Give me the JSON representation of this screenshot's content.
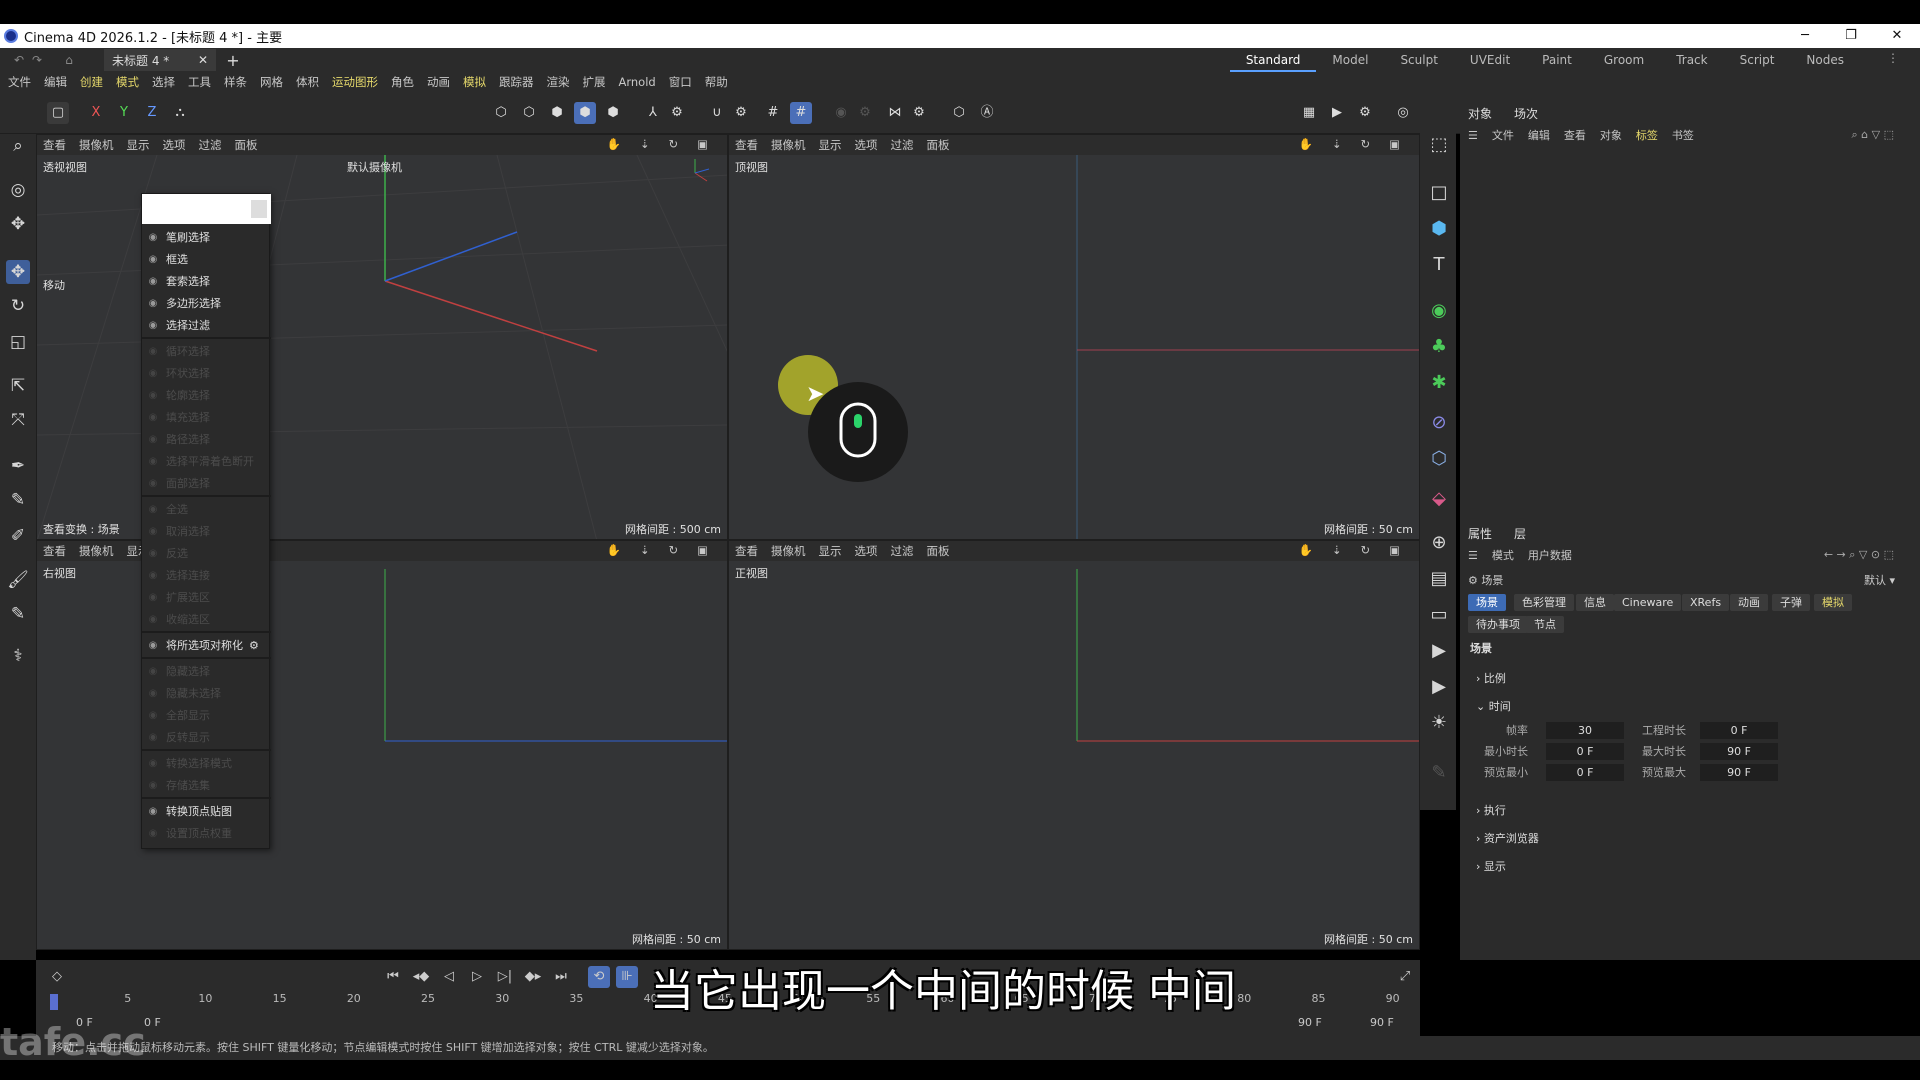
{
  "app": {
    "title": "Cinema 4D 2026.1.2 - [未标题 4 *] - 主要",
    "window_controls": [
      "─",
      "❐",
      "✕"
    ]
  },
  "tabs": {
    "doc_tab": "未标题 4 *",
    "close": "✕",
    "add": "+",
    "layouts": [
      "Standard",
      "Model",
      "Sculpt",
      "UVEdit",
      "Paint",
      "Groom",
      "Track",
      "Script",
      "Nodes"
    ],
    "active_layout": "Standard"
  },
  "menu": [
    "文件",
    "编辑",
    "创建",
    "模式",
    "选择",
    "工具",
    "样条",
    "网格",
    "体积",
    "运动图形",
    "角色",
    "动画",
    "模拟",
    "跟踪器",
    "渲染",
    "扩展",
    "Arnold",
    "窗口",
    "帮助"
  ],
  "axes_buttons": [
    "X",
    "Y",
    "Z"
  ],
  "viewports": {
    "menu": [
      "查看",
      "摄像机",
      "显示",
      "选项",
      "过滤",
      "面板"
    ],
    "perspective": {
      "name": "透视视图",
      "camera": "默认摄像机",
      "grid": "网格间距 : 500 cm",
      "tool": "移动",
      "transform": "查看变换 : 场景"
    },
    "top": {
      "name": "顶视图",
      "grid": "网格间距 : 50 cm"
    },
    "right": {
      "name": "右视图",
      "grid": "网格间距 : 50 cm"
    },
    "front": {
      "name": "正视图",
      "grid": "网格间距 : 50 cm"
    }
  },
  "context_menu": {
    "items": [
      {
        "label": "笔刷选择",
        "enabled": true
      },
      {
        "label": "框选",
        "enabled": true
      },
      {
        "label": "套索选择",
        "enabled": true
      },
      {
        "label": "多边形选择",
        "enabled": true
      },
      {
        "label": "选择过滤",
        "enabled": true
      },
      {
        "label": "循环选择",
        "enabled": false
      },
      {
        "label": "环状选择",
        "enabled": false
      },
      {
        "label": "轮廓选择",
        "enabled": false
      },
      {
        "label": "填充选择",
        "enabled": false
      },
      {
        "label": "路径选择",
        "enabled": false
      },
      {
        "label": "选择平滑着色断开",
        "enabled": false
      },
      {
        "label": "面部选择",
        "enabled": false
      },
      {
        "label": "全选",
        "enabled": false
      },
      {
        "label": "取消选择",
        "enabled": false
      },
      {
        "label": "反选",
        "enabled": false
      },
      {
        "label": "选择连接",
        "enabled": false
      },
      {
        "label": "扩展选区",
        "enabled": false
      },
      {
        "label": "收缩选区",
        "enabled": false
      },
      {
        "label": "将所选项对称化",
        "enabled": true
      },
      {
        "label": "隐藏选择",
        "enabled": false
      },
      {
        "label": "隐藏未选择",
        "enabled": false
      },
      {
        "label": "全部显示",
        "enabled": false
      },
      {
        "label": "反转显示",
        "enabled": false
      },
      {
        "label": "转换选择模式",
        "enabled": false
      },
      {
        "label": "存储选集",
        "enabled": false
      },
      {
        "label": "转换顶点贴图",
        "enabled": true
      },
      {
        "label": "设置顶点权重",
        "enabled": false
      }
    ]
  },
  "object_panel": {
    "tabs": [
      "对象",
      "场次"
    ],
    "menu": [
      "文件",
      "编辑",
      "查看",
      "对象",
      "标签",
      "书签"
    ]
  },
  "attributes_panel": {
    "tabs": [
      "属性",
      "层"
    ],
    "menu": [
      "模式",
      "用户数据"
    ],
    "context": "场景",
    "preset": "默认",
    "chips_row1": [
      "场景",
      "色彩管理",
      "信息",
      "Cineware",
      "XRefs",
      "动画",
      "子弹",
      "模拟"
    ],
    "chips_row2": [
      "待办事项",
      "节点"
    ],
    "heading": "场景",
    "groups": [
      "比例",
      "时间",
      "执行",
      "资产浏览器",
      "显示"
    ],
    "time_fields": [
      {
        "label": "帧率",
        "value": "30",
        "label2": "工程时长",
        "value2": "0 F"
      },
      {
        "label": "最小时长",
        "value": "0 F",
        "label2": "最大时长",
        "value2": "90 F"
      },
      {
        "label": "预览最小",
        "value": "0 F",
        "label2": "预览最大",
        "value2": "90 F"
      }
    ]
  },
  "timeline": {
    "ticks": [
      "0",
      "5",
      "10",
      "15",
      "20",
      "25",
      "30",
      "35",
      "40",
      "45",
      "50",
      "55",
      "60",
      "65",
      "70",
      "75",
      "80",
      "85",
      "90"
    ],
    "start": "0 F",
    "current": "0 F",
    "end": "90 F",
    "end2": "90 F"
  },
  "status": "移动：点击并拖动鼠标移动元素。按住 SHIFT 键量化移动；节点编辑模式时按住 SHIFT 键增加选择对象；按住 CTRL 键减少选择对象。",
  "overlay": {
    "subtitle": "当它出现一个中间的时候  中间",
    "watermark": "tafe.cc"
  },
  "colors": {
    "accent": "#4b6fb8",
    "axis_x": "#c04040",
    "axis_y": "#40b040",
    "axis_z": "#4060d0"
  }
}
